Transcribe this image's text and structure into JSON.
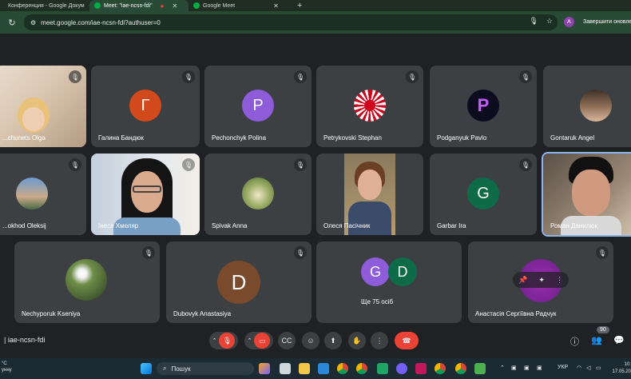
{
  "browser": {
    "tabs": [
      {
        "label": "Конференция - Google Докум",
        "color": "#4285f4"
      },
      {
        "label": "Meet: \"iae-ncsn-fdi\"",
        "color": "#00ac47"
      },
      {
        "label": "Google Meet",
        "color": "#00ac47"
      }
    ],
    "url": "meet.google.com/iae-ncsn-fdi?authuser=0",
    "profile_initial": "A",
    "update_label": "Завершити оновлення"
  },
  "participants": [
    {
      "name": "...chunets Olga",
      "type": "photo"
    },
    {
      "name": "Галина Бандюк",
      "type": "letter",
      "letter": "Г",
      "color": "#d24a1b"
    },
    {
      "name": "Pechonchyk Polina",
      "type": "letter",
      "letter": "P",
      "color": "#8e5cd8"
    },
    {
      "name": "Petrykovski Stephan",
      "type": "avatar"
    },
    {
      "name": "Podganyuk Pavlo",
      "type": "avatar"
    },
    {
      "name": "Gontaruk Angel",
      "type": "avatar"
    },
    {
      "name": "...okhod Oleksij",
      "type": "avatar"
    },
    {
      "name": "Інеса Хмеляр",
      "type": "photo"
    },
    {
      "name": "Spivak Anna",
      "type": "avatar"
    },
    {
      "name": "Олеся Пасічник",
      "type": "photo"
    },
    {
      "name": "Garbar Ira",
      "type": "letter",
      "letter": "G",
      "color": "#0e6b48"
    },
    {
      "name": "Роман Данилюк",
      "type": "photo"
    },
    {
      "name": "Nechyporuk Kseniya",
      "type": "avatar"
    },
    {
      "name": "Dubovyk Anastasiya",
      "type": "letter",
      "letter": "D",
      "color": "#7a4a2c"
    },
    {
      "name": "Ще 75 осіб",
      "type": "group",
      "letters": [
        "G",
        "D"
      ]
    },
    {
      "name": "Анастасія Сергіївна Радчук",
      "type": "avatar"
    }
  ],
  "meeting": {
    "code": "iae-ncsn-fdi",
    "participant_count": "90"
  },
  "taskbar": {
    "weather_temp": "°C",
    "weather_text": "унну",
    "search_placeholder": "Пошук",
    "lang": "УКР",
    "time": "10:",
    "date": "17.05.20"
  },
  "colors": {
    "accent_red": "#ea4335",
    "tile_bg": "#3c4043",
    "page_bg": "#202124"
  }
}
